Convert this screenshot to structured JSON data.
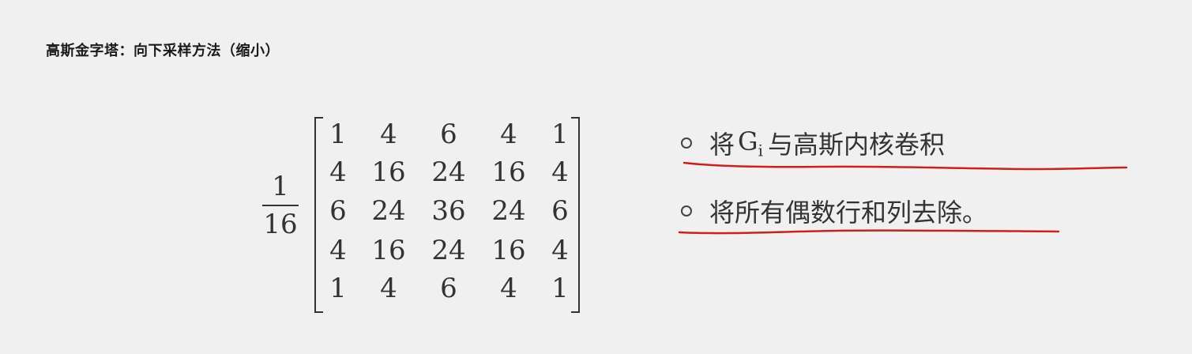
{
  "title": "高斯金字塔：向下采样方法（缩小）",
  "formula": {
    "numerator": "1",
    "denominator": "16",
    "matrix": [
      [
        "1",
        "4",
        "6",
        "4",
        "1"
      ],
      [
        "4",
        "16",
        "24",
        "16",
        "4"
      ],
      [
        "6",
        "24",
        "36",
        "24",
        "6"
      ],
      [
        "4",
        "16",
        "24",
        "16",
        "4"
      ],
      [
        "1",
        "4",
        "6",
        "4",
        "1"
      ]
    ]
  },
  "bullets": {
    "item1_prefix": "将",
    "item1_symbol": "G",
    "item1_subscript": "i",
    "item1_suffix": "与高斯内核卷积",
    "item2": "将所有偶数行和列去除。"
  },
  "annotation_color": "#cc1f1f"
}
